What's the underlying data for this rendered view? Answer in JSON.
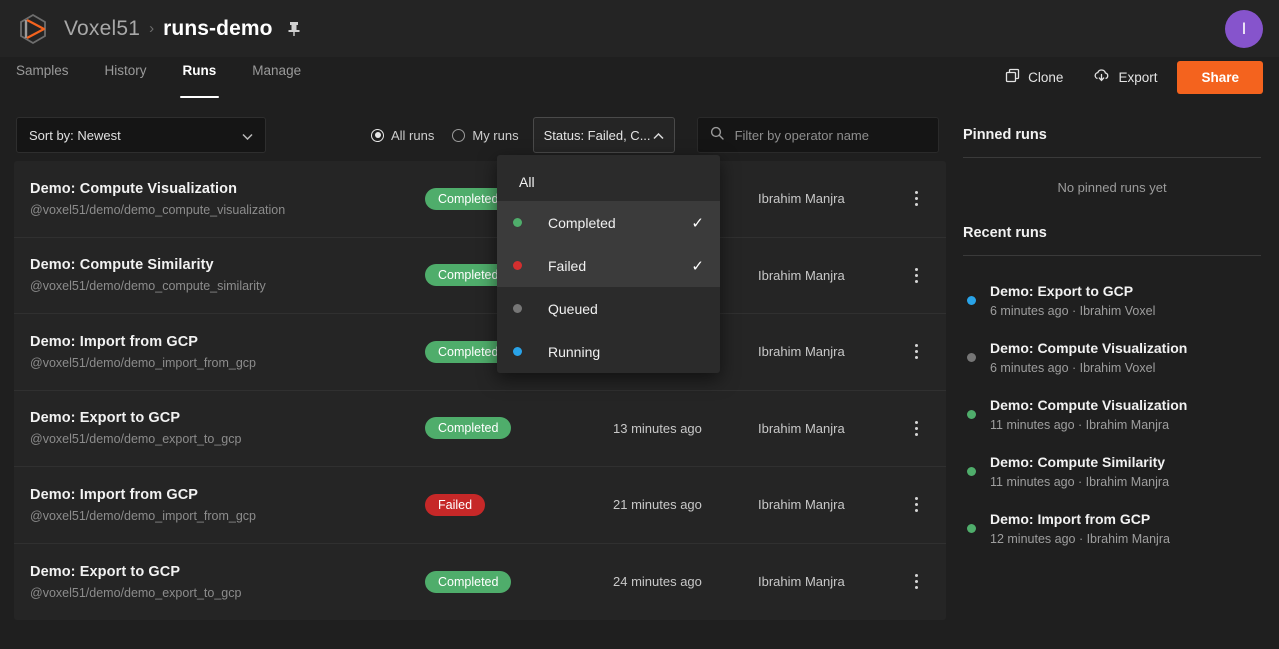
{
  "header": {
    "brand": "Voxel51",
    "separator": "›",
    "dataset": "runs-demo",
    "avatar_initial": "I"
  },
  "nav": {
    "tabs": [
      {
        "label": "Samples",
        "active": false
      },
      {
        "label": "History",
        "active": false
      },
      {
        "label": "Runs",
        "active": true
      },
      {
        "label": "Manage",
        "active": false
      }
    ],
    "actions": {
      "clone": "Clone",
      "export": "Export",
      "share": "Share"
    }
  },
  "toolbar": {
    "sort_label": "Sort by: Newest",
    "radios": [
      {
        "label": "All runs",
        "checked": true
      },
      {
        "label": "My runs",
        "checked": false
      }
    ],
    "status_label": "Status: Failed, C...",
    "search_placeholder": "Filter by operator name",
    "search_value": ""
  },
  "status_menu": {
    "items": [
      {
        "label": "All",
        "dot": null,
        "checked": false
      },
      {
        "label": "Completed",
        "dot": "#4fad6b",
        "checked": true
      },
      {
        "label": "Failed",
        "dot": "#d32f2f",
        "checked": true
      },
      {
        "label": "Queued",
        "dot": "#767676",
        "checked": false
      },
      {
        "label": "Running",
        "dot": "#29a3e8",
        "checked": false
      }
    ],
    "check_glyph": "✓"
  },
  "runs": [
    {
      "title": "Demo: Compute Visualization",
      "path": "@voxel51/demo/demo_compute_visualization",
      "status": "Completed",
      "status_kind": "completed",
      "time": "",
      "user": "Ibrahim Manjra"
    },
    {
      "title": "Demo: Compute Similarity",
      "path": "@voxel51/demo/demo_compute_similarity",
      "status": "Completed",
      "status_kind": "completed",
      "time": "",
      "user": "Ibrahim Manjra"
    },
    {
      "title": "Demo: Import from GCP",
      "path": "@voxel51/demo/demo_import_from_gcp",
      "status": "Completed",
      "status_kind": "completed",
      "time": "",
      "user": "Ibrahim Manjra"
    },
    {
      "title": "Demo: Export to GCP",
      "path": "@voxel51/demo/demo_export_to_gcp",
      "status": "Completed",
      "status_kind": "completed",
      "time": "13 minutes ago",
      "user": "Ibrahim Manjra"
    },
    {
      "title": "Demo: Import from GCP",
      "path": "@voxel51/demo/demo_import_from_gcp",
      "status": "Failed",
      "status_kind": "failed",
      "time": "21 minutes ago",
      "user": "Ibrahim Manjra"
    },
    {
      "title": "Demo: Export to GCP",
      "path": "@voxel51/demo/demo_export_to_gcp",
      "status": "Completed",
      "status_kind": "completed",
      "time": "24 minutes ago",
      "user": "Ibrahim Manjra"
    }
  ],
  "sidebar": {
    "pinned_heading": "Pinned runs",
    "pinned_empty": "No pinned runs yet",
    "recent_heading": "Recent runs",
    "recent": [
      {
        "title": "Demo: Export to GCP",
        "meta": "6 minutes ago  ·  Ibrahim Voxel",
        "dot": "#29a3e8"
      },
      {
        "title": "Demo: Compute Visualization",
        "meta": "6 minutes ago  ·  Ibrahim Voxel",
        "dot": "#767676"
      },
      {
        "title": "Demo: Compute Visualization",
        "meta": "11 minutes ago  ·  Ibrahim Manjra",
        "dot": "#4fad6b"
      },
      {
        "title": "Demo: Compute Similarity",
        "meta": "11 minutes ago  ·  Ibrahim Manjra",
        "dot": "#4fad6b"
      },
      {
        "title": "Demo: Import from GCP",
        "meta": "12 minutes ago  ·  Ibrahim Manjra",
        "dot": "#4fad6b"
      }
    ]
  },
  "colors": {
    "accent": "#f4631e",
    "avatar": "#8654cc",
    "completed": "#4fad6b",
    "failed": "#c62828",
    "running": "#29a3e8",
    "queued": "#767676"
  }
}
